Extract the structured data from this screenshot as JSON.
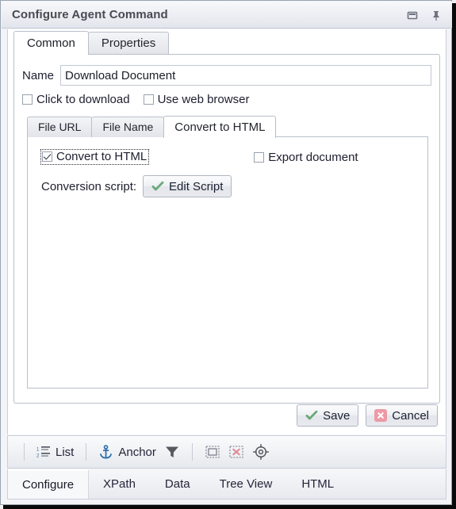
{
  "window": {
    "title": "Configure Agent Command",
    "buttons": [
      {
        "name": "restore-icon",
        "label": "Restore"
      },
      {
        "name": "pin-icon",
        "label": "Pin"
      }
    ]
  },
  "outer_tabs": [
    {
      "label": "Common",
      "selected": true
    },
    {
      "label": "Properties",
      "selected": false
    }
  ],
  "form": {
    "name_label": "Name",
    "name_value": "Download Document",
    "name_placeholder": "",
    "checkboxes": [
      {
        "label": "Click to download",
        "checked": false
      },
      {
        "label": "Use web browser",
        "checked": false
      }
    ]
  },
  "inner_tabs": [
    {
      "label": "File URL",
      "selected": false
    },
    {
      "label": "File Name",
      "selected": false
    },
    {
      "label": "Convert to HTML",
      "selected": true
    }
  ],
  "convert_panel": {
    "convert_checkbox": {
      "label": "Convert to HTML",
      "checked": true,
      "focused": true
    },
    "export_checkbox": {
      "label": "Export document",
      "checked": false
    },
    "script_label": "Conversion script:",
    "edit_script_button": "Edit Script"
  },
  "actions": {
    "save_label": "Save",
    "cancel_label": "Cancel"
  },
  "toolbar": {
    "items": [
      {
        "icon": "numbered-list-icon",
        "label": "List"
      },
      {
        "icon": "anchor-icon",
        "label": "Anchor"
      },
      {
        "icon": "filter-funnel-icon",
        "label": ""
      },
      {
        "icon": "select-region-icon",
        "label": ""
      },
      {
        "icon": "clear-selection-icon",
        "label": ""
      },
      {
        "icon": "target-crosshair-icon",
        "label": ""
      }
    ]
  },
  "bottom_tabs": [
    {
      "label": "Configure",
      "selected": true
    },
    {
      "label": "XPath",
      "selected": false
    },
    {
      "label": "Data",
      "selected": false
    },
    {
      "label": "Tree View",
      "selected": false
    },
    {
      "label": "HTML",
      "selected": false
    }
  ],
  "colors": {
    "accent_green": "#6aa87a",
    "accent_red": "#ec9aa6",
    "accent_blue": "#2a6aa8",
    "title_text": "#4a4a52"
  }
}
